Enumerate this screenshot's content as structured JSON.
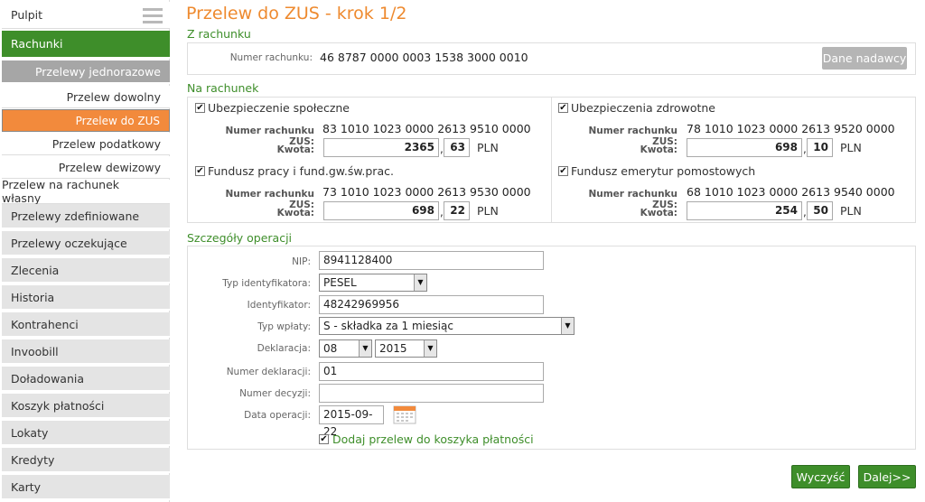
{
  "sidebar": {
    "items": [
      {
        "label": "Pulpit"
      },
      {
        "label": "Rachunki"
      },
      {
        "label": "Przelewy jednorazowe"
      },
      {
        "label": "Przelew dowolny"
      },
      {
        "label": "Przelew do ZUS"
      },
      {
        "label": "Przelew podatkowy"
      },
      {
        "label": "Przelew dewizowy"
      },
      {
        "label": "Przelew na rachunek własny"
      },
      {
        "label": "Przelewy zdefiniowane"
      },
      {
        "label": "Przelewy oczekujące"
      },
      {
        "label": "Zlecenia"
      },
      {
        "label": "Historia"
      },
      {
        "label": "Kontrahenci"
      },
      {
        "label": "Invoobill"
      },
      {
        "label": "Doładowania"
      },
      {
        "label": "Koszyk płatności"
      },
      {
        "label": "Lokaty"
      },
      {
        "label": "Kredyty"
      },
      {
        "label": "Karty"
      }
    ]
  },
  "page": {
    "title": "Przelew do ZUS - krok 1/2"
  },
  "from_account": {
    "section_title": "Z rachunku",
    "label": "Numer rachunku:",
    "number": "46 8787 0000 0003 1538 3000 0010",
    "sender_button": "Dane nadawcy"
  },
  "to_account": {
    "section_title": "Na rachunek",
    "account_label": "Numer rachunku ZUS:",
    "amount_label": "Kwota:",
    "currency": "PLN",
    "parts": [
      {
        "name": "Ubezpieczenie społeczne",
        "checked": "✔",
        "account": "83 1010 1023 0000 2613 9510 0000",
        "amount_int": "2365",
        "amount_dec": "63"
      },
      {
        "name": "Ubezpieczenia zdrowotne",
        "checked": "✔",
        "account": "78 1010 1023 0000 2613 9520 0000",
        "amount_int": "698",
        "amount_dec": "10"
      },
      {
        "name": "Fundusz pracy i fund.gw.św.prac.",
        "checked": "✔",
        "account": "73 1010 1023 0000 2613 9530 0000",
        "amount_int": "698",
        "amount_dec": "22"
      },
      {
        "name": "Fundusz emerytur pomostowych",
        "checked": "✔",
        "account": "68 1010 1023 0000 2613 9540 0000",
        "amount_int": "254",
        "amount_dec": "50"
      }
    ]
  },
  "details": {
    "section_title": "Szczegóły operacji",
    "nip_label": "NIP:",
    "nip": "8941128400",
    "id_type_label": "Typ identyfikatora:",
    "id_type": "PESEL",
    "id_label": "Identyfikator:",
    "id": "48242969956",
    "payment_type_label": "Typ wpłaty:",
    "payment_type": "S - składka za 1 miesiąc",
    "declaration_label": "Deklaracja:",
    "declaration_month": "08",
    "declaration_year": "2015",
    "declaration_number_label": "Numer deklaracji:",
    "declaration_number": "01",
    "decision_number_label": "Numer decyzji:",
    "decision_number": "",
    "date_label": "Data operacji:",
    "date": "2015-09-22",
    "basket_checked": "✔",
    "basket_label": "Dodaj przelew do koszyka płatności"
  },
  "actions": {
    "clear": "Wyczyść",
    "next": "Dalej>>"
  },
  "colors": {
    "green": "#3e8e2a",
    "orange": "#f28a3c",
    "title": "#ee8a2f"
  }
}
